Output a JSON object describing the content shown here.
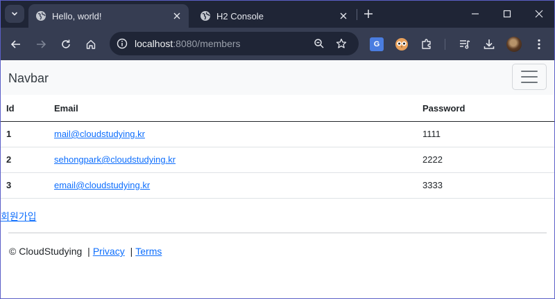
{
  "browser": {
    "tabs": [
      {
        "title": "Hello, world!",
        "active": true
      },
      {
        "title": "H2 Console",
        "active": false
      }
    ],
    "address": {
      "host": "localhost",
      "rest": ":8080/members"
    }
  },
  "navbar": {
    "brand": "Navbar"
  },
  "table": {
    "headers": [
      "Id",
      "Email",
      "Password"
    ],
    "rows": [
      {
        "id": "1",
        "email": "mail@cloudstudying.kr",
        "password": "1111"
      },
      {
        "id": "2",
        "email": "sehongpark@cloudstudying.kr",
        "password": "2222"
      },
      {
        "id": "3",
        "email": "email@cloudstudying.kr",
        "password": "3333"
      }
    ]
  },
  "signup_link": "회원가입",
  "footer": {
    "copyright": "© CloudStudying",
    "separator": "|",
    "privacy": "Privacy",
    "terms": "Terms"
  },
  "colors": {
    "link": "#0d6efd",
    "tab_strip": "#1f2536",
    "toolbar": "#363d52",
    "navbar_bg": "#f8f9fa"
  }
}
